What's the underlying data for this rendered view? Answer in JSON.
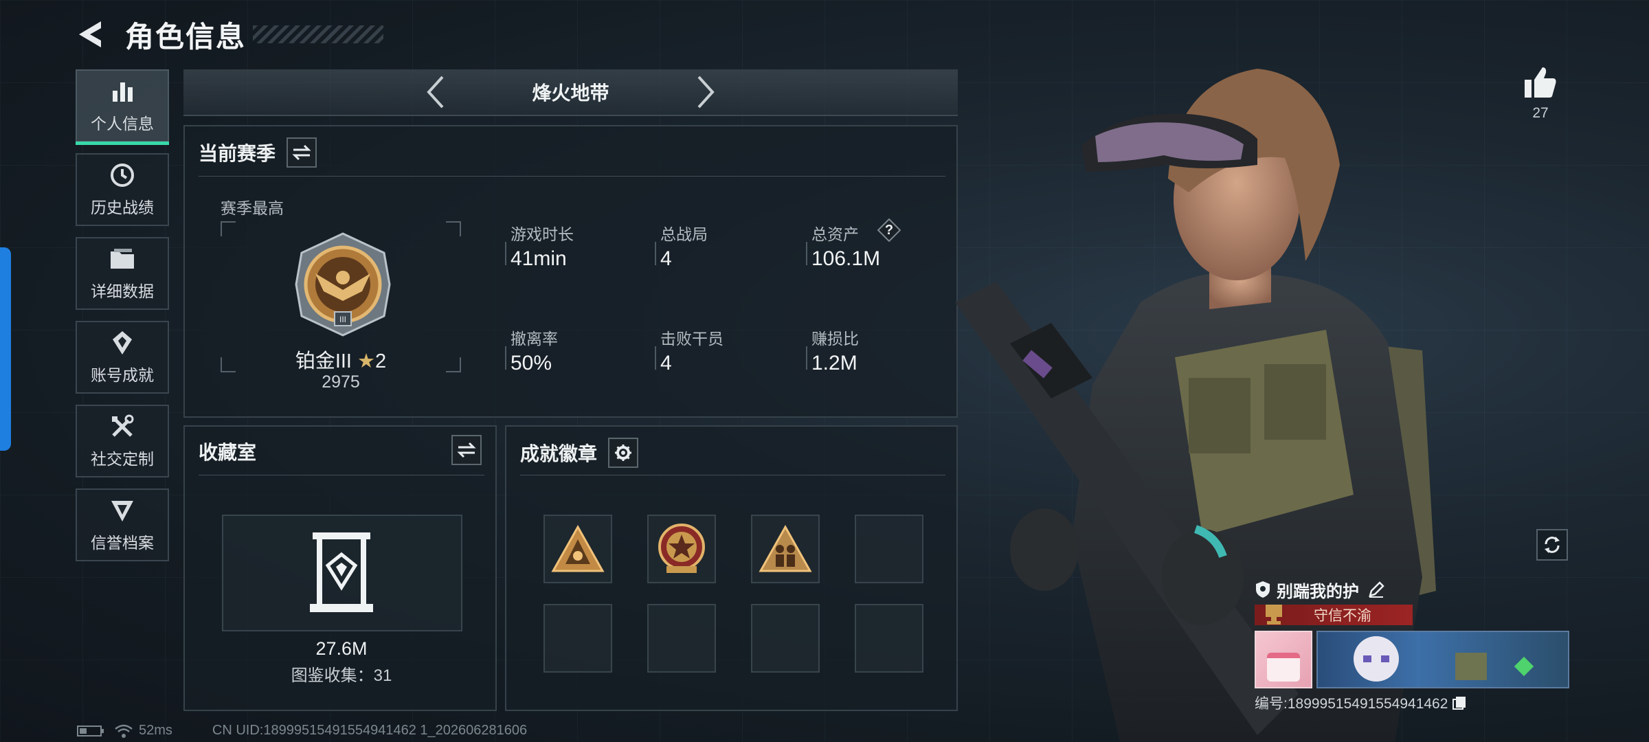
{
  "header": {
    "title": "角色信息",
    "back_icon": "back-arrow-icon"
  },
  "sidebar": {
    "items": [
      {
        "label": "个人信息",
        "icon": "bar-chart-icon",
        "active": true
      },
      {
        "label": "历史战绩",
        "icon": "clock-history-icon",
        "active": false
      },
      {
        "label": "详细数据",
        "icon": "folder-icon",
        "active": false
      },
      {
        "label": "账号成就",
        "icon": "achievement-icon",
        "active": false
      },
      {
        "label": "社交定制",
        "icon": "tools-icon",
        "active": false
      },
      {
        "label": "信誉档案",
        "icon": "credit-badge-icon",
        "active": false
      }
    ]
  },
  "map_selector": {
    "name": "烽火地带"
  },
  "season": {
    "title": "当前赛季",
    "best_label": "赛季最高",
    "rank_name": "铂金III",
    "rank_stars": "2",
    "rank_score": "2975",
    "stats": [
      {
        "label": "游戏时长",
        "value": "41min"
      },
      {
        "label": "总战局",
        "value": "4"
      },
      {
        "label": "总资产",
        "value": "106.1M",
        "help": "?"
      },
      {
        "label": "撤离率",
        "value": "50%"
      },
      {
        "label": "击败干员",
        "value": "4"
      },
      {
        "label": "赚损比",
        "value": "1.2M"
      }
    ]
  },
  "collection": {
    "title": "收藏室",
    "value": "27.6M",
    "count_text": "图鉴收集：31"
  },
  "achievements": {
    "title": "成就徽章",
    "filled_slots": 3,
    "total_slots": 8
  },
  "profile": {
    "likes": "27",
    "player_name": "别踹我的护",
    "title_badge": "守信不渝",
    "id_text": "编号:18999515491554941462"
  },
  "footer": {
    "ping": "52ms",
    "uid": "CN UID:18999515491554941462 1_202606281606"
  },
  "colors": {
    "accent": "#38d9a9",
    "edge": "#1f7fe0",
    "badge_red": "#9c2424"
  }
}
